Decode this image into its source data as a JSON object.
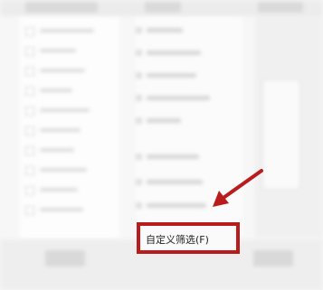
{
  "menu": {
    "custom_filter_label": "自定义筛选(F)"
  },
  "colors": {
    "highlight": "#b81c1c",
    "arrow": "#b81c1c"
  },
  "icons": [
    "arrow-pointer-icon"
  ]
}
